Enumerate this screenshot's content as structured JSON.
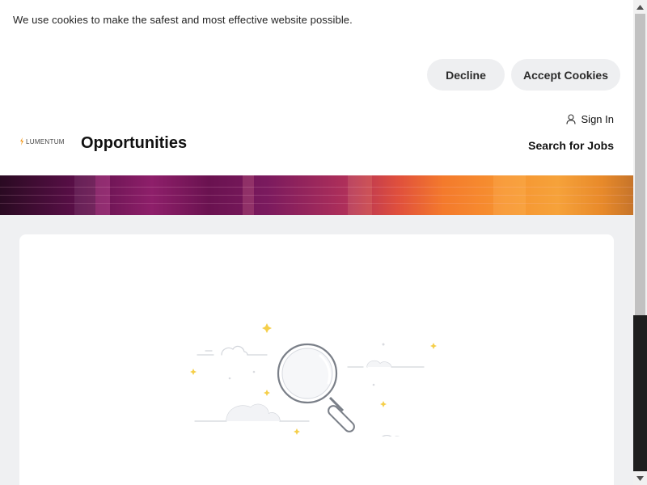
{
  "cookie_banner": {
    "message": "We use cookies to make the safest and most effective website possible.",
    "decline_label": "Decline",
    "accept_label": "Accept Cookies"
  },
  "header": {
    "logo_text": "LUMENTUM",
    "page_title": "Opportunities",
    "sign_in_label": "Sign In",
    "search_jobs_label": "Search for Jobs"
  },
  "icons": {
    "sign_in": "user-icon",
    "empty_state": "magnifying-glass-illustration",
    "scroll_up": "chevron-up-icon",
    "scroll_down": "chevron-down-icon"
  },
  "colors": {
    "button_bg": "#eeeff1",
    "page_bg": "#eff0f2",
    "hero_start": "#2a0a22",
    "hero_mid": "#8e1f6a",
    "hero_end": "#f79430",
    "sparkle": "#f5cf4a",
    "logo_accent": "#f39a1e"
  }
}
